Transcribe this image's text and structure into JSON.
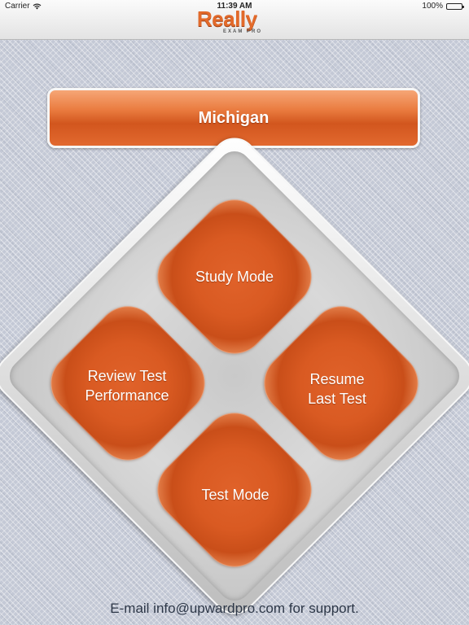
{
  "status_bar": {
    "carrier": "Carrier",
    "time": "11:39 AM",
    "battery": "100%"
  },
  "header": {
    "logo_text": "Really",
    "logo_subtext": "EXAM PRO"
  },
  "state_selector": {
    "label": "Michigan"
  },
  "menu": {
    "study_mode": "Study Mode",
    "resume_line1": "Resume",
    "resume_line2": "Last Test",
    "review_line1": "Review Test",
    "review_line2": "Performance",
    "test_mode": "Test Mode"
  },
  "footer": {
    "support": "E-mail info@upwardpro.com for support."
  },
  "colors": {
    "accent": "#e0622a",
    "background": "#c4c9d6"
  }
}
